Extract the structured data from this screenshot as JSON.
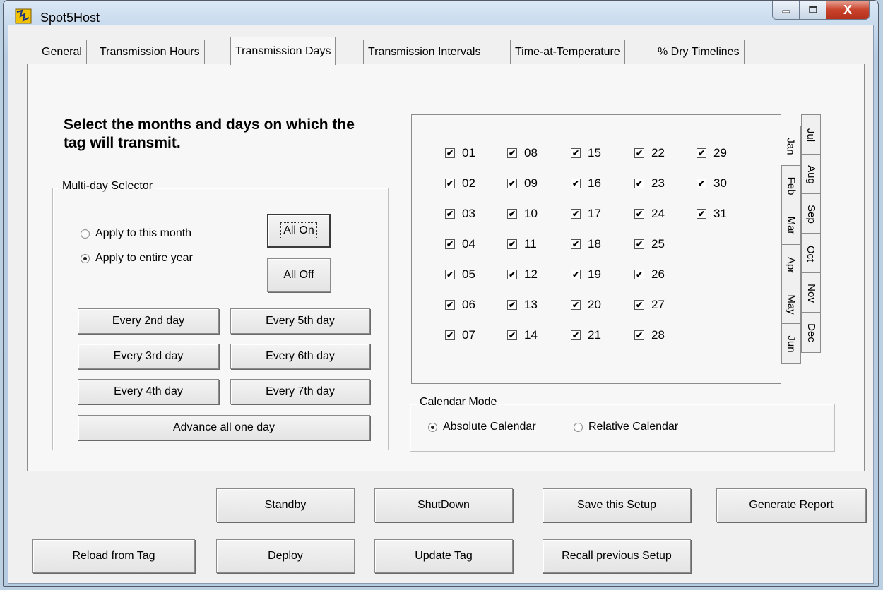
{
  "window": {
    "title": "Spot5Host",
    "close_glyph": "X"
  },
  "tabs": [
    "General",
    "Transmission Hours",
    "Transmission Days",
    "Transmission Intervals",
    "Time-at-Temperature",
    "% Dry Timelines"
  ],
  "active_tab": "Transmission Days",
  "heading": "Select the months and days on which the tag will transmit.",
  "multi_day": {
    "label": "Multi-day Selector",
    "radio_month": "Apply to this month",
    "radio_year": "Apply to entire year",
    "selected": "year",
    "all_on": "All On",
    "all_off": "All Off",
    "every2": "Every 2nd day",
    "every3": "Every 3rd day",
    "every4": "Every 4th day",
    "every5": "Every 5th day",
    "every6": "Every 6th day",
    "every7": "Every 7th day",
    "advance": "Advance all one day"
  },
  "days": [
    "01",
    "02",
    "03",
    "04",
    "05",
    "06",
    "07",
    "08",
    "09",
    "10",
    "11",
    "12",
    "13",
    "14",
    "15",
    "16",
    "17",
    "18",
    "19",
    "20",
    "21",
    "22",
    "23",
    "24",
    "25",
    "26",
    "27",
    "28",
    "29",
    "30",
    "31"
  ],
  "all_days_checked": true,
  "months": {
    "left": [
      "Jan",
      "Feb",
      "Mar",
      "Apr",
      "May",
      "Jun"
    ],
    "right": [
      "Jul",
      "Aug",
      "Sep",
      "Oct",
      "Nov",
      "Dec"
    ],
    "active": "Jan"
  },
  "calendar_mode": {
    "label": "Calendar Mode",
    "absolute": "Absolute Calendar",
    "relative": "Relative Calendar",
    "selected": "absolute"
  },
  "bottom_buttons": {
    "standby": "Standby",
    "shutdown": "ShutDown",
    "save_setup": "Save this Setup",
    "generate_report": "Generate Report",
    "reload": "Reload from Tag",
    "deploy": "Deploy",
    "update": "Update Tag",
    "recall": "Recall previous Setup"
  }
}
